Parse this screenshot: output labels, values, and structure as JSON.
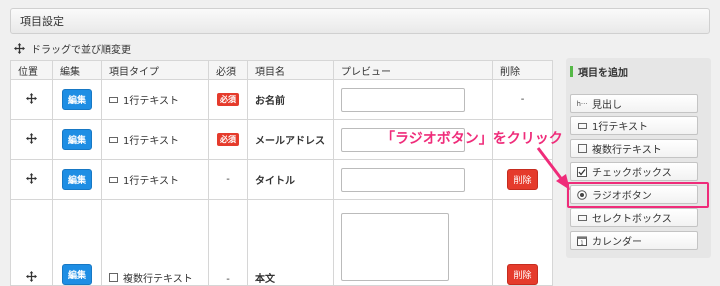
{
  "header": {
    "title": "項目設定"
  },
  "drag_hint": "ドラッグで並び順変更",
  "table": {
    "columns": [
      "位置",
      "編集",
      "項目タイプ",
      "必須",
      "項目名",
      "プレビュー",
      "削除"
    ],
    "edit_label": "編集",
    "delete_label": "削除",
    "rows": [
      {
        "type": "1行テキスト",
        "type_icon": "single-line-icon",
        "required": "必須",
        "name": "お名前",
        "preview": "input",
        "delete": "-"
      },
      {
        "type": "1行テキスト",
        "type_icon": "single-line-icon",
        "required": "必須",
        "name": "メールアドレス",
        "preview": "input",
        "delete": ""
      },
      {
        "type": "1行テキスト",
        "type_icon": "single-line-icon",
        "required": "-",
        "name": "タイトル",
        "preview": "input",
        "delete": "削除"
      },
      {
        "type": "複数行テキスト",
        "type_icon": "multi-line-icon",
        "required": "-",
        "name": "本文",
        "preview": "textarea",
        "delete": "削除"
      }
    ]
  },
  "side": {
    "title": "項目を追加",
    "buttons": [
      {
        "label": "見出し",
        "icon": "heading-icon"
      },
      {
        "label": "1行テキスト",
        "icon": "single-line-icon"
      },
      {
        "label": "複数行テキスト",
        "icon": "multi-line-icon"
      },
      {
        "label": "チェックボックス",
        "icon": "checkbox-icon"
      },
      {
        "label": "ラジオボタン",
        "icon": "radio-icon"
      },
      {
        "label": "セレクトボックス",
        "icon": "select-icon"
      },
      {
        "label": "カレンダー",
        "icon": "calendar-icon"
      }
    ]
  },
  "annotation": "「ラジオボタン」をクリック",
  "colors": {
    "edit": "#1e8ee4",
    "danger": "#e53b2c",
    "highlight": "#ef2c7a",
    "accent": "#55b847"
  }
}
